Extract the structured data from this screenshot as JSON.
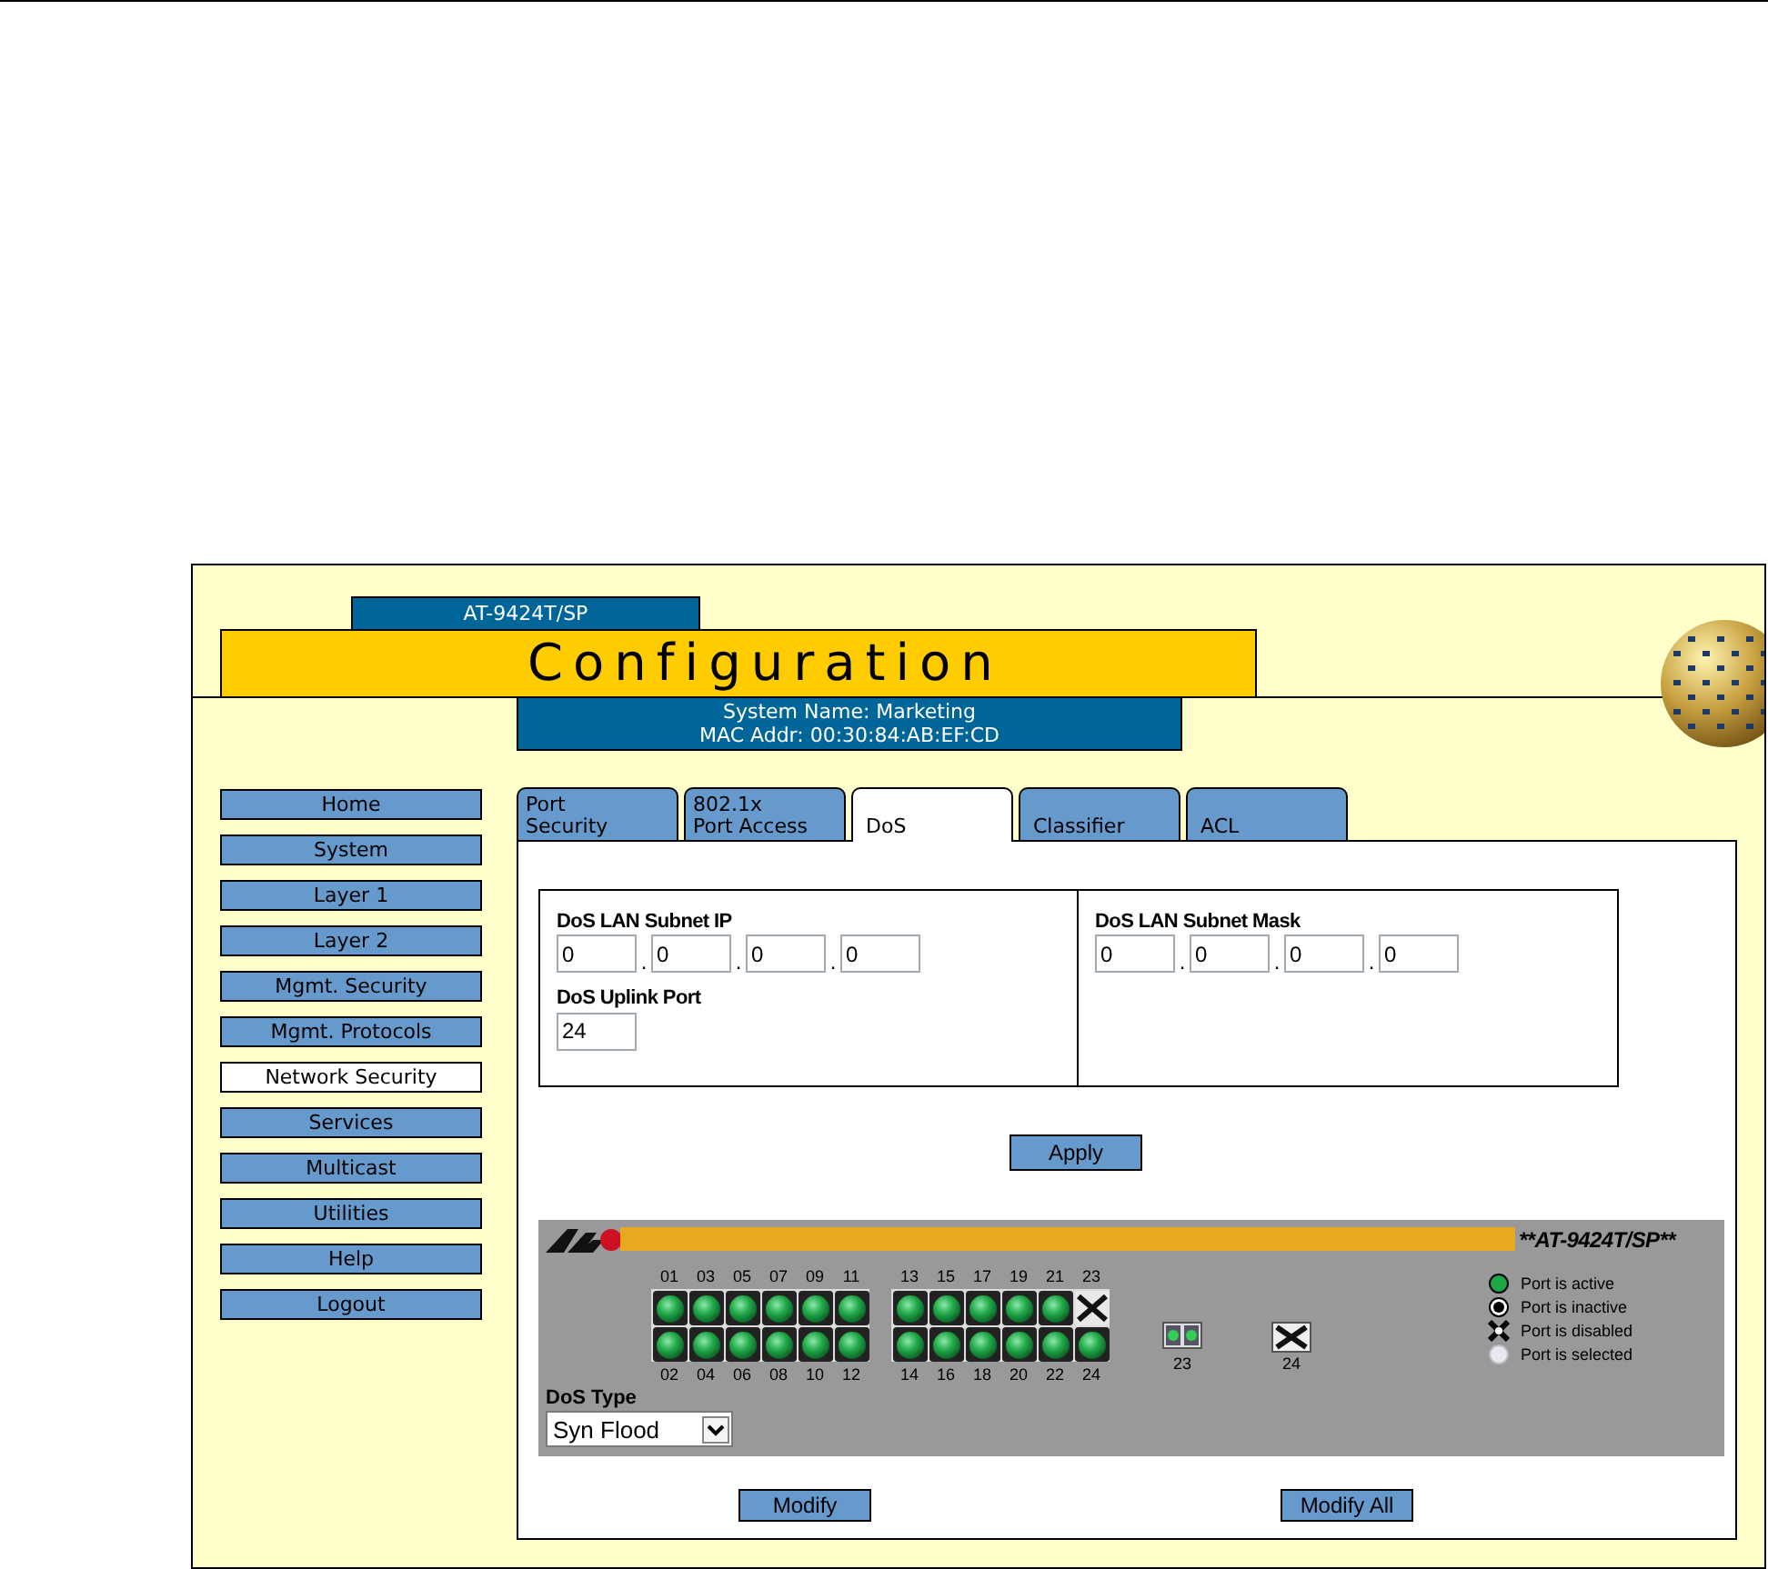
{
  "header": {
    "model_tab": "AT-9424T/SP",
    "title": "Configuration",
    "system_name": "System Name: Marketing",
    "mac_addr": "MAC Addr: 00:30:84:AB:EF:CD"
  },
  "sidebar": {
    "items": [
      {
        "label": "Home",
        "selected": false
      },
      {
        "label": "System",
        "selected": false
      },
      {
        "label": "Layer 1",
        "selected": false
      },
      {
        "label": "Layer 2",
        "selected": false
      },
      {
        "label": "Mgmt. Security",
        "selected": false
      },
      {
        "label": "Mgmt. Protocols",
        "selected": false
      },
      {
        "label": "Network Security",
        "selected": true
      },
      {
        "label": "Services",
        "selected": false
      },
      {
        "label": "Multicast",
        "selected": false
      },
      {
        "label": "Utilities",
        "selected": false
      },
      {
        "label": "Help",
        "selected": false
      },
      {
        "label": "Logout",
        "selected": false
      }
    ]
  },
  "tabs": [
    {
      "label": "Port\nSecurity",
      "selected": false
    },
    {
      "label": "802.1x\nPort Access",
      "selected": false
    },
    {
      "label": "DoS",
      "selected": true
    },
    {
      "label": "Classifier",
      "selected": false
    },
    {
      "label": "ACL",
      "selected": false
    }
  ],
  "form": {
    "subnet_ip": {
      "label": "DoS LAN Subnet IP",
      "octets": [
        "0",
        "0",
        "0",
        "0"
      ],
      "separators": [
        ".",
        ".",
        "."
      ]
    },
    "uplink_port": {
      "label": "DoS Uplink Port",
      "value": "24"
    },
    "subnet_mask": {
      "label": "DoS LAN Subnet Mask",
      "octets": [
        "0",
        "0",
        "0",
        "0"
      ],
      "separators": [
        ".",
        ".",
        "."
      ]
    },
    "apply_button": "Apply"
  },
  "device": {
    "title": "**AT-9424T/SP**",
    "ports": [
      {
        "number": "01",
        "disabled": false
      },
      {
        "number": "02",
        "disabled": false
      },
      {
        "number": "03",
        "disabled": false
      },
      {
        "number": "04",
        "disabled": false
      },
      {
        "number": "05",
        "disabled": false
      },
      {
        "number": "06",
        "disabled": false
      },
      {
        "number": "07",
        "disabled": false
      },
      {
        "number": "08",
        "disabled": false
      },
      {
        "number": "09",
        "disabled": false
      },
      {
        "number": "10",
        "disabled": false
      },
      {
        "number": "11",
        "disabled": false
      },
      {
        "number": "12",
        "disabled": false
      },
      {
        "number": "13",
        "disabled": false
      },
      {
        "number": "14",
        "disabled": false
      },
      {
        "number": "15",
        "disabled": false
      },
      {
        "number": "16",
        "disabled": false
      },
      {
        "number": "17",
        "disabled": false
      },
      {
        "number": "18",
        "disabled": false
      },
      {
        "number": "19",
        "disabled": false
      },
      {
        "number": "20",
        "disabled": false
      },
      {
        "number": "21",
        "disabled": false
      },
      {
        "number": "22",
        "disabled": false
      },
      {
        "number": "23",
        "disabled": true
      },
      {
        "number": "24",
        "disabled": false
      }
    ],
    "uplinks": [
      {
        "number": "23",
        "disabled": false
      },
      {
        "number": "24",
        "disabled": true
      }
    ],
    "legend": [
      {
        "kind": "active",
        "label": "Port is active"
      },
      {
        "kind": "inactive",
        "label": "Port is inactive"
      },
      {
        "kind": "disabled",
        "label": "Port is disabled"
      },
      {
        "kind": "selected",
        "label": "Port is selected"
      }
    ],
    "dos_type": {
      "label": "DoS Type",
      "value": "Syn Flood"
    }
  },
  "buttons": [
    "Modify",
    "Modify All"
  ]
}
